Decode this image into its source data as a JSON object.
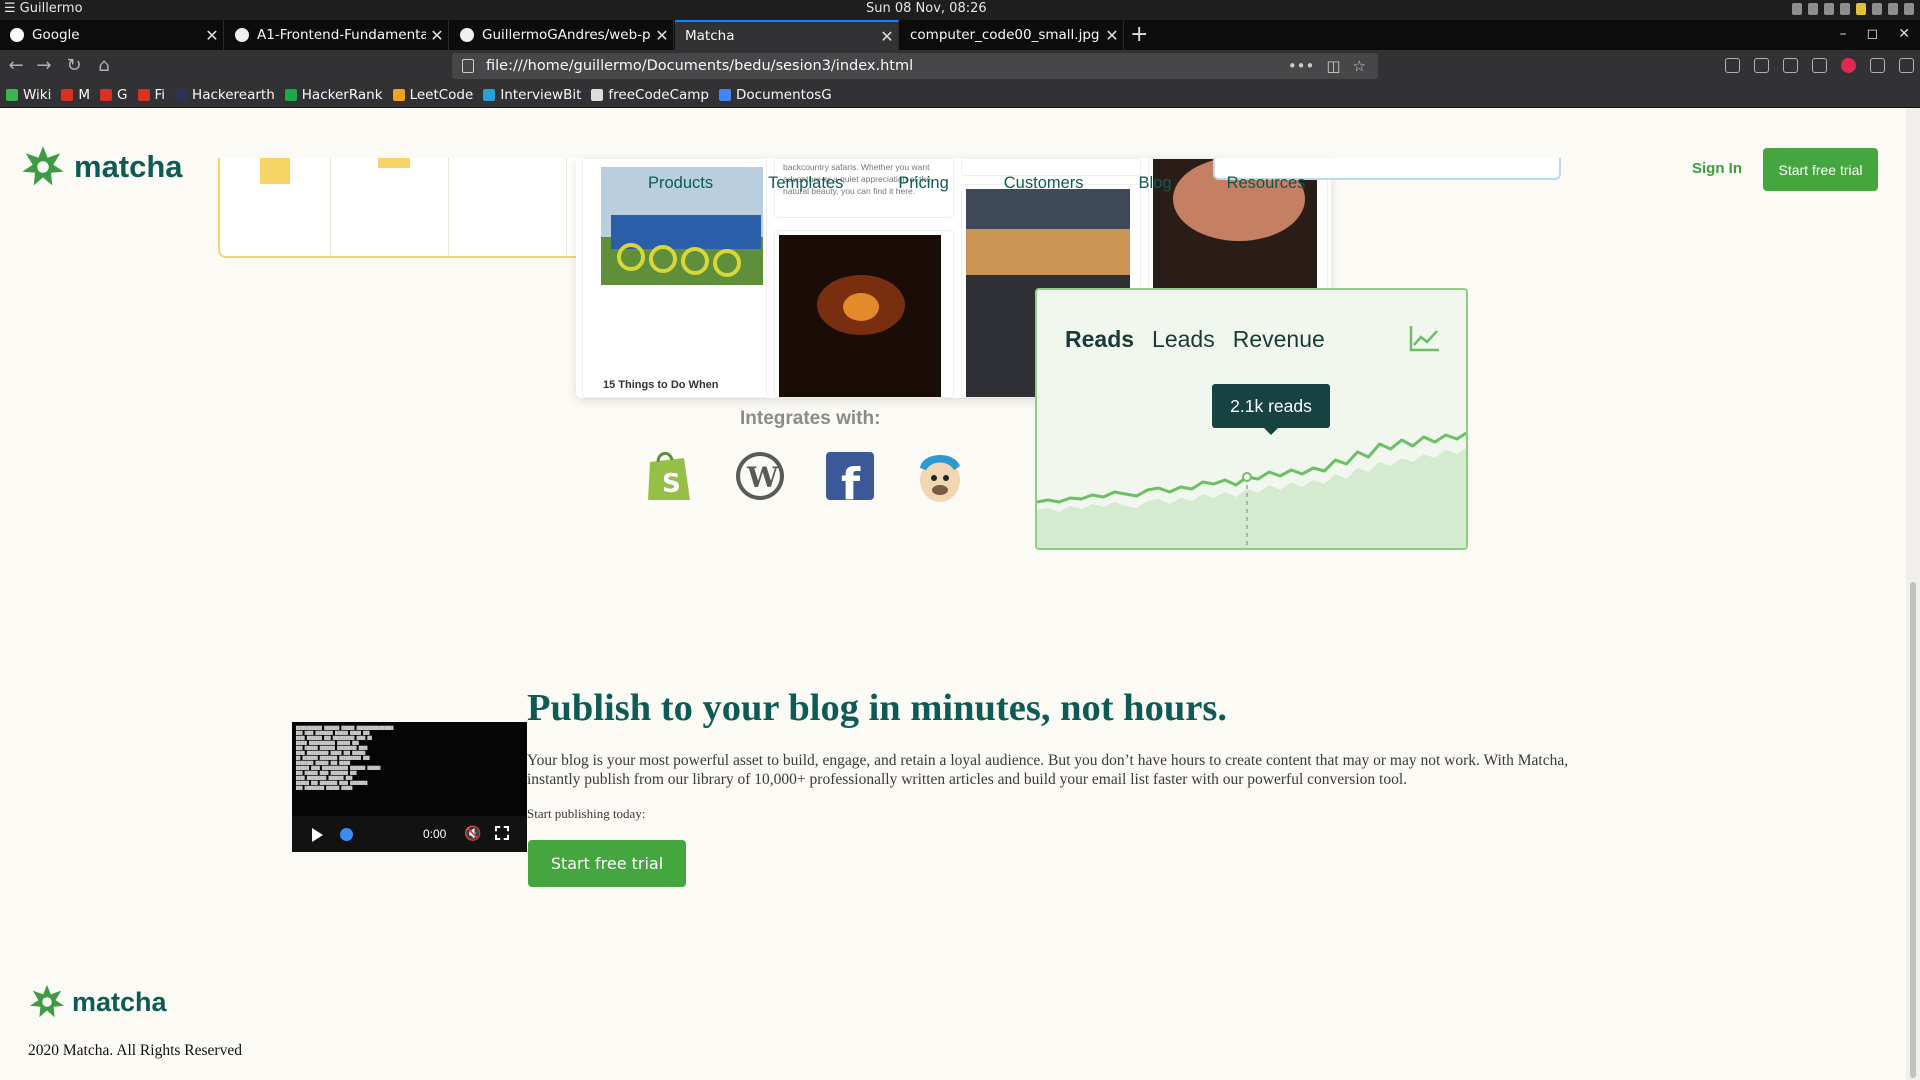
{
  "os": {
    "user": "Guillermo",
    "clock": "Sun 08 Nov, 08:26"
  },
  "browser": {
    "tabs": [
      {
        "title": "Google"
      },
      {
        "title": "A1-Frontend-Fundamenta"
      },
      {
        "title": "GuillermoGAndres/web-p"
      },
      {
        "title": "Matcha"
      },
      {
        "title": "computer_code00_small.jpg ("
      }
    ],
    "url": "file:///home/guillermo/Documents/bedu/sesion3/index.html",
    "bookmarks": [
      "Wiki",
      "M",
      "G",
      "Fi",
      "Hackerearth",
      "HackerRank",
      "LeetCode",
      "InterviewBit",
      "freeCodeCamp",
      "DocumentosG"
    ]
  },
  "site": {
    "brand": "matcha",
    "nav": [
      "Products",
      "Templates",
      "Pricing",
      "Customers",
      "Blog",
      "Resources"
    ],
    "sign_in": "Sign In",
    "start_trial": "Start free trial"
  },
  "hero": {
    "blog_caption": "15 Things to Do When",
    "blog_snippet": "backcountry safaris. Whether you want adventure or a quiet appreciation of the natural beauty, you can find it here.",
    "integrates_label": "Integrates with:",
    "integrations": [
      "shopify-icon",
      "wordpress-icon",
      "facebook-icon",
      "mailchimp-icon"
    ]
  },
  "chart": {
    "tabs": [
      "Reads",
      "Leads",
      "Revenue"
    ],
    "active_tab": "Reads",
    "tooltip": "2.1k reads",
    "accent": "#6cbf63",
    "fill": "#d4ebcf"
  },
  "chart_data": {
    "type": "area",
    "series": [
      {
        "values": [
          0.3,
          0.32,
          0.3,
          0.34,
          0.33,
          0.37,
          0.35,
          0.4,
          0.38,
          0.36,
          0.42,
          0.44,
          0.4,
          0.45,
          0.43,
          0.5,
          0.48,
          0.52,
          0.47,
          0.55,
          0.53,
          0.6,
          0.56,
          0.62,
          0.58,
          0.64,
          0.61,
          0.72,
          0.68,
          0.8,
          0.75,
          0.88,
          0.83,
          0.92,
          0.86,
          0.95,
          0.9,
          0.97,
          0.93,
          1.0
        ]
      },
      {
        "values": [
          0.22,
          0.24,
          0.2,
          0.26,
          0.23,
          0.28,
          0.25,
          0.3,
          0.26,
          0.24,
          0.31,
          0.33,
          0.28,
          0.34,
          0.31,
          0.38,
          0.34,
          0.4,
          0.35,
          0.43,
          0.39,
          0.47,
          0.42,
          0.5,
          0.45,
          0.52,
          0.48,
          0.58,
          0.53,
          0.64,
          0.6,
          0.7,
          0.66,
          0.74,
          0.7,
          0.78,
          0.74,
          0.82,
          0.78,
          0.85
        ]
      }
    ],
    "highlight_index": 19
  },
  "publish": {
    "title": "Publish to your blog in minutes, not hours.",
    "body": "Your blog is your most powerful asset to build, engage, and retain a loyal audience. But you don’t have hours to create content that may or may not work. With Matcha, instantly publish from our library of 10,000+ professionally written articles and build your email list faster with our powerful conversion tool.",
    "subtitle": "Start publishing today:",
    "cta": "Start free trial",
    "video_time": "0:00"
  },
  "footer": {
    "brand": "matcha",
    "copyright": "2020 Matcha. All Rights Reserved"
  }
}
